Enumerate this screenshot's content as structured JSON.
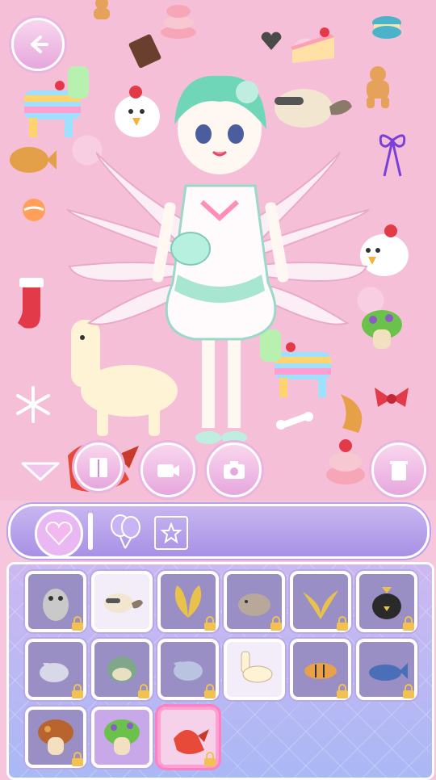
{
  "screen": {
    "name": "dress-up-pet-selection"
  },
  "colors": {
    "background": "#f6bfd8",
    "panel": "#cdb8f1",
    "accent": "#ff7fc2",
    "lock": "#f2c14e"
  },
  "top_controls": [
    {
      "id": "back",
      "icon": "back-arrow-icon"
    }
  ],
  "action_buttons": [
    {
      "id": "hide",
      "icon": "chevron-down-icon"
    },
    {
      "id": "wardrobe",
      "icon": "wardrobe-icon"
    },
    {
      "id": "video",
      "icon": "video-camera-icon"
    },
    {
      "id": "photo",
      "icon": "camera-icon"
    },
    {
      "id": "delete",
      "icon": "trash-icon"
    }
  ],
  "category_tabs": [
    {
      "id": "crystal-heart",
      "icon": "crystal-heart-icon",
      "active": true
    },
    {
      "id": "balloons",
      "icon": "balloons-icon",
      "active": false
    },
    {
      "id": "sticker-frame",
      "icon": "star-frame-icon",
      "active": false
    }
  ],
  "items": [
    {
      "name": "owl",
      "locked": true
    },
    {
      "name": "raccoon",
      "locked": false
    },
    {
      "name": "butterfly-wings",
      "locked": true
    },
    {
      "name": "hamster",
      "locked": true
    },
    {
      "name": "fox-tail",
      "locked": true
    },
    {
      "name": "black-chick",
      "locked": true
    },
    {
      "name": "cat",
      "locked": true
    },
    {
      "name": "pufferfish",
      "locked": true
    },
    {
      "name": "wolf",
      "locked": true
    },
    {
      "name": "llama",
      "locked": false
    },
    {
      "name": "tiger",
      "locked": true
    },
    {
      "name": "whale",
      "locked": true
    },
    {
      "name": "brown-mushroom",
      "locked": true
    },
    {
      "name": "green-mushroom",
      "locked": false
    },
    {
      "name": "dragon",
      "locked": true,
      "selected": true
    }
  ]
}
